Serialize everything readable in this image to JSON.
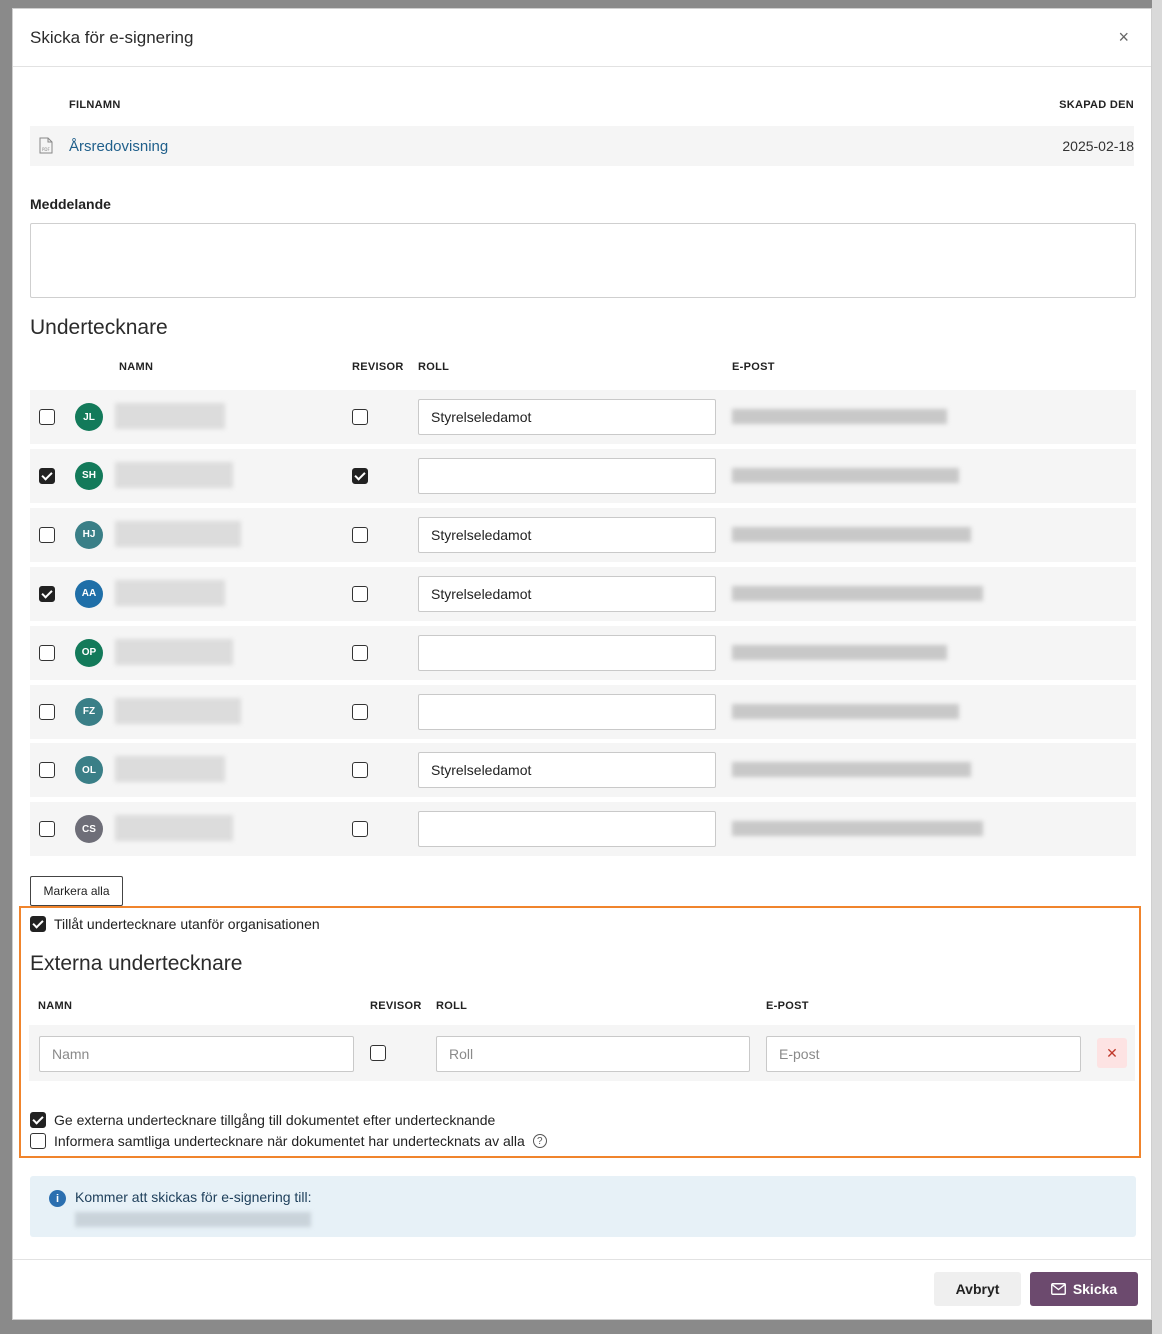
{
  "modal": {
    "title": "Skicka för e-signering",
    "close_label": "×"
  },
  "file": {
    "header_name": "FILNAMN",
    "header_created": "SKAPAD DEN",
    "name": "Årsredovisning",
    "created": "2025-02-18",
    "icon": "pdf-file-icon"
  },
  "message": {
    "label": "Meddelande",
    "value": ""
  },
  "signers": {
    "title": "Undertecknare",
    "headers": {
      "name": "NAMN",
      "auditor": "REVISOR",
      "role": "ROLL",
      "email": "E-POST"
    },
    "rows": [
      {
        "initials": "JL",
        "avatar_color": "#137a5a",
        "selected": false,
        "auditor": false,
        "role": "Styrelseledamot"
      },
      {
        "initials": "SH",
        "avatar_color": "#137a5a",
        "selected": true,
        "auditor": true,
        "role": ""
      },
      {
        "initials": "HJ",
        "avatar_color": "#3a7f87",
        "selected": false,
        "auditor": false,
        "role": "Styrelseledamot"
      },
      {
        "initials": "AA",
        "avatar_color": "#1f6fa8",
        "selected": true,
        "auditor": false,
        "role": "Styrelseledamot"
      },
      {
        "initials": "OP",
        "avatar_color": "#137a5a",
        "selected": false,
        "auditor": false,
        "role": ""
      },
      {
        "initials": "FZ",
        "avatar_color": "#3a7f87",
        "selected": false,
        "auditor": false,
        "role": ""
      },
      {
        "initials": "OL",
        "avatar_color": "#3a7f87",
        "selected": false,
        "auditor": false,
        "role": "Styrelseledamot"
      },
      {
        "initials": "CS",
        "avatar_color": "#6e6e78",
        "selected": false,
        "auditor": false,
        "role": ""
      }
    ],
    "select_all_label": "Markera alla"
  },
  "external": {
    "allow_label": "Tillåt undertecknare utanför organisationen",
    "allow_checked": true,
    "title": "Externa undertecknare",
    "headers": {
      "name": "NAMN",
      "auditor": "REVISOR",
      "role": "ROLL",
      "email": "E-POST"
    },
    "row": {
      "name_placeholder": "Namn",
      "role_placeholder": "Roll",
      "email_placeholder": "E-post",
      "auditor": false,
      "remove_label": "✕"
    },
    "access_label": "Ge externa undertecknare tillgång till dokumentet efter undertecknande",
    "access_checked": true,
    "inform_label": "Informera samtliga undertecknare när dokumentet har undertecknats av alla",
    "inform_checked": false,
    "help_icon": "question-circle-icon"
  },
  "info": {
    "icon": "info-icon",
    "text": "Kommer att skickas för e-signering till:"
  },
  "footer": {
    "cancel_label": "Avbryt",
    "send_label": "Skicka",
    "send_icon": "envelope-icon"
  },
  "colors": {
    "highlight": "#f0842c",
    "primary_button": "#6c4a6e",
    "link": "#1f5f8b",
    "info_bg": "#e7f1f7"
  }
}
